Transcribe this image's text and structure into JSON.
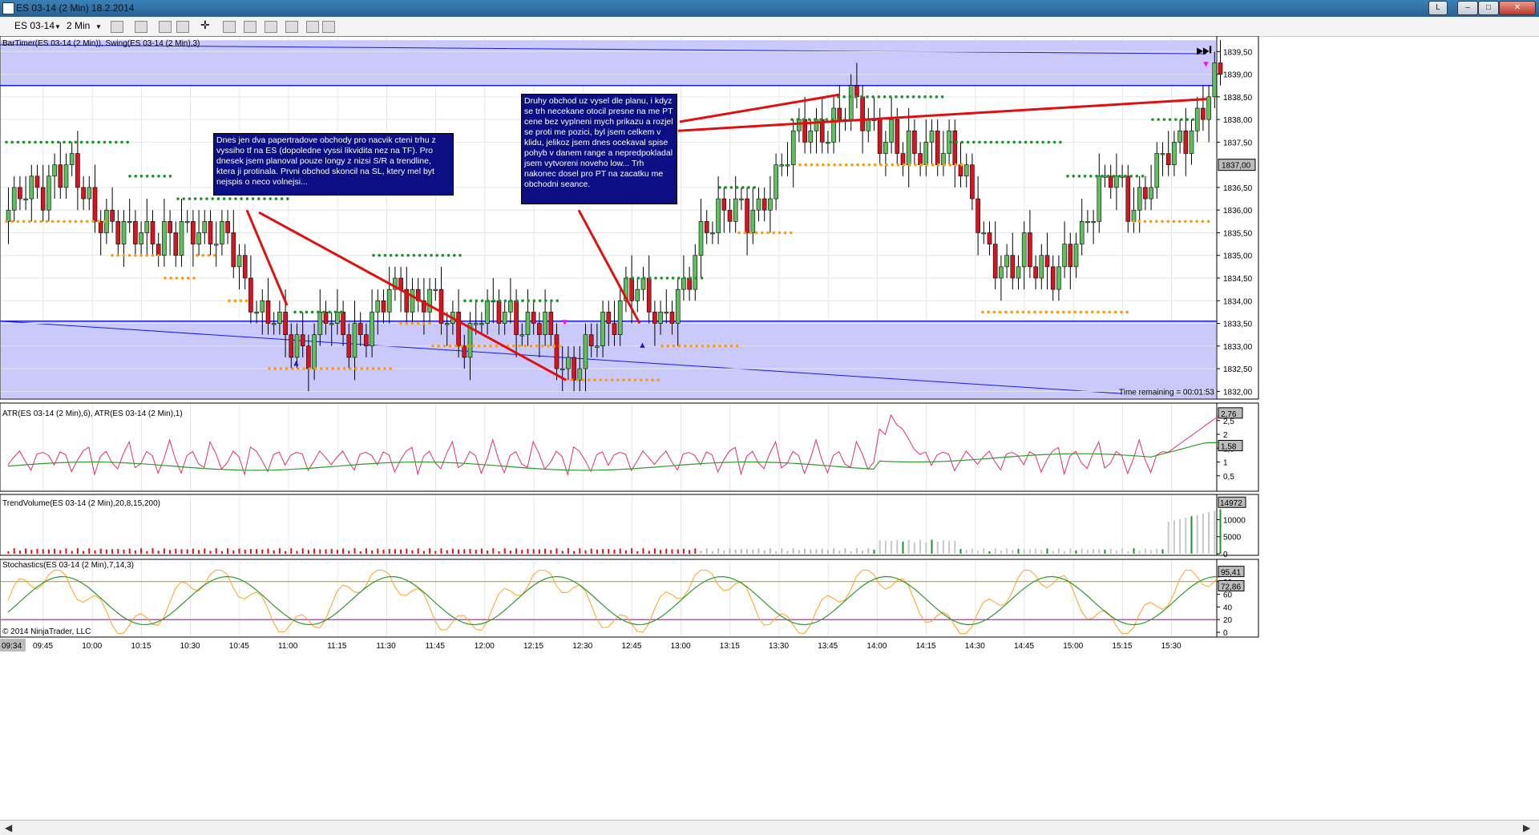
{
  "window": {
    "title": "ES 03-14 (2 Min)  18.2.2014",
    "buttons": [
      "L",
      "–",
      "□",
      "✕"
    ]
  },
  "toolbar": {
    "instrument": "ES 03-14",
    "interval": "2 Min",
    "tools": [
      "bar-type-icon",
      "draw-icon",
      "crosshair-icon",
      "snap-icon",
      "zoom-icon",
      "data-box-icon",
      "properties-icon",
      "strategy-icon",
      "chart-trader-icon",
      "templates-icon"
    ]
  },
  "panels": {
    "price": {
      "label": "BarTimer(ES 03-14 (2 Min)), Swing(ES 03-14 (2 Min),3)",
      "time_remaining": "Time remaining = 00:01:53",
      "axis": [
        "1839,50",
        "1839,00",
        "1838,50",
        "1838,00",
        "1837,50",
        "1836,50",
        "1836,00",
        "1835,50",
        "1835,00",
        "1834,50",
        "1834,00",
        "1833,50",
        "1833,00",
        "1832,50",
        "1832,00"
      ],
      "last_price": "1837,00",
      "annotation1": "Dnes jen dva papertradove obchody pro nacvik cteni trhu z vyssiho tf na ES (dopoledne vyssi likvidita nez na TF). Pro dnesek jsem planoval pouze longy z nizsi S/R a trendline, ktera ji protinala. Prvni obchod skoncil na SL, ktery mel byt nejspis o neco volnejsi...",
      "annotation2": "Druhy obchod uz vysel dle planu, i kdyz se trh necekane otocil presne na me PT cene bez vyplneni mych prikazu a rozjel se proti me pozici, byl jsem celkem v klidu, jelikoz jsem dnes ocekaval spise pohyb v danem range a nepredpokladal jsem vytvoreni noveho low... Trh nakonec dosel pro PT na zacatku me obchodni seance."
    },
    "atr": {
      "label": "ATR(ES 03-14 (2 Min),6), ATR(ES 03-14 (2 Min),1)",
      "axis": [
        "2,5",
        "2",
        "1,5",
        "1",
        "0,5"
      ],
      "badges": [
        "2,76",
        "1,58"
      ]
    },
    "volume": {
      "label": "TrendVolume(ES 03-14 (2 Min),20,8,15,200)",
      "axis": [
        "10000",
        "5000",
        "0"
      ],
      "badge": "14972"
    },
    "stoch": {
      "label": "Stochastics(ES 03-14 (2 Min),7,14,3)",
      "axis": [
        "80",
        "60",
        "40",
        "20",
        "0"
      ],
      "badges": [
        "95,41",
        "72,86"
      ],
      "copyright": "© 2014 NinjaTrader, LLC"
    }
  },
  "time_axis": {
    "first_label": "09:34",
    "labels": [
      "09:45",
      "10:00",
      "10:15",
      "10:30",
      "10:45",
      "11:00",
      "11:15",
      "11:30",
      "11:45",
      "12:00",
      "12:15",
      "12:30",
      "12:45",
      "13:00",
      "13:15",
      "13:30",
      "13:45",
      "14:00",
      "14:15",
      "14:30",
      "14:45",
      "15:00",
      "15:15",
      "15:30"
    ]
  },
  "colors": {
    "up": "#5ec15e",
    "down": "#d9131f",
    "zone": "#c9c9fb",
    "line_blue": "#1a1ae0",
    "trend_red": "#e01010",
    "swing_high": "#1f8f2f",
    "swing_low": "#ff9a10",
    "annotation_bg": "#0c0f84"
  },
  "chart_data": {
    "type": "candlestick",
    "xlabel": "",
    "ylabel": "",
    "ylim": [
      1831.9,
      1839.7
    ],
    "x_labels": [
      "09:45",
      "10:00",
      "10:15",
      "10:30",
      "10:45",
      "11:00",
      "11:15",
      "11:30",
      "11:45",
      "12:00",
      "12:15",
      "12:30",
      "12:45",
      "13:00",
      "13:15",
      "13:30",
      "13:45",
      "14:00",
      "14:15",
      "14:30",
      "14:45",
      "15:00",
      "15:15",
      "15:30"
    ],
    "price_start": 1836.0,
    "price_close_path": [
      1836.0,
      1836.3,
      1836.5,
      1836.9,
      1836.7,
      1836.4,
      1835.9,
      1835.6,
      1835.3,
      1835.7,
      1835.4,
      1835.2,
      1835.5,
      1835.7,
      1835.4,
      1834.9,
      1834.2,
      1833.8,
      1833.2,
      1833.0,
      1833.2,
      1833.6,
      1833.2,
      1833.3,
      1833.5,
      1834.0,
      1834.4,
      1834.1,
      1833.9,
      1833.6,
      1833.2,
      1833.6,
      1833.7,
      1833.8,
      1833.4,
      1833.5,
      1833.0,
      1832.5,
      1832.7,
      1833.2,
      1833.8,
      1834.4,
      1833.9,
      1833.6,
      1834.0,
      1834.5,
      1835.5,
      1836.2,
      1836.1,
      1835.6,
      1836.4,
      1837.1,
      1837.5,
      1837.7,
      1837.9,
      1838.1,
      1838.3,
      1837.9,
      1837.7,
      1837.1,
      1837.3,
      1837.6,
      1837.2,
      1836.9,
      1836.0,
      1834.9,
      1834.4,
      1835.2,
      1834.8,
      1834.3,
      1835.0,
      1835.8,
      1836.3,
      1836.6,
      1836.2,
      1836.4,
      1836.8,
      1837.4,
      1837.9,
      1838.3,
      1838.9
    ]
  }
}
